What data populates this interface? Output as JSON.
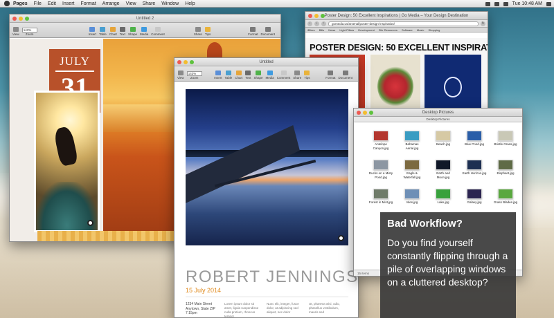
{
  "menubar": {
    "app": "Pages",
    "items": [
      "File",
      "Edit",
      "Insert",
      "Format",
      "Arrange",
      "View",
      "Share",
      "Window",
      "Help"
    ],
    "clock": "Tue 10:48 AM"
  },
  "toolbar": {
    "zoom_value": "143%",
    "view_label": "View",
    "zoom_label": "Zoom",
    "insert_label": "Insert",
    "table_label": "Table",
    "chart_label": "Chart",
    "text_label": "Text",
    "shape_label": "Shape",
    "media_label": "Media",
    "comment_label": "Comment",
    "share_label": "Share",
    "tips_label": "Tips",
    "format_label": "Format",
    "document_label": "Document"
  },
  "pages1": {
    "title": "Untitled 2",
    "month": "JULY",
    "day": "31"
  },
  "pages2": {
    "title": "Untitled",
    "name": "ROBERT JENNINGS",
    "date": "15 July 2014",
    "address_lines": [
      "1234 Main Street",
      "Anytown, State ZIP",
      "7:15pm"
    ],
    "col2": "Lorem ipsum dolor sit amet, ligula suspendisse nulla pretium, rhoncus tempor",
    "col3": "Nunc elit, integer, fusce dolor, at adipiscing sed aliquet, nec dolor",
    "col4": "Ut, pharetra wisi, odio, phasellus vestibulum, mauris sed"
  },
  "browser": {
    "title": "Poster Design: 50 Excellent Inspirations | Go Media – Your Design Destination",
    "url": "gomedia.us/arsenal/poster-design-inspiration/",
    "bookmarks": [
      "iBikes",
      "Bills",
      "News",
      "Light Pillars",
      "Development",
      "Zikr Resources",
      "Software",
      "Music",
      "Shopping"
    ],
    "headline": "POSTER DESIGN: 50 EXCELLENT INSPIRATIONS"
  },
  "finder": {
    "title": "Desktop Pictures",
    "path_label": "Desktop Pictures",
    "files": [
      {
        "name": "Antelope Canyon.jpg",
        "color": "#b3362e"
      },
      {
        "name": "Bahamas Aerial.jpg",
        "color": "#3a9cc2"
      },
      {
        "name": "Beach.jpg",
        "color": "#d6c9a4"
      },
      {
        "name": "Blue Pond.jpg",
        "color": "#2a5ea8"
      },
      {
        "name": "Bristle Grass.jpg",
        "color": "#c9c8b6"
      },
      {
        "name": "Ducks on a Misty Pond.jpg",
        "color": "#8c96a2"
      },
      {
        "name": "Eagle & Waterfall.jpg",
        "color": "#7c6a40"
      },
      {
        "name": "Earth and Moon.jpg",
        "color": "#101828"
      },
      {
        "name": "Earth Horizon.jpg",
        "color": "#1d2f52"
      },
      {
        "name": "Elephant.jpg",
        "color": "#5f6b46"
      },
      {
        "name": "Forest in Mist.jpg",
        "color": "#6f7b69"
      },
      {
        "name": "Isles.jpg",
        "color": "#6e8fb6"
      },
      {
        "name": "Lake.jpg",
        "color": "#38a13c"
      },
      {
        "name": "Galaxy.jpg",
        "color": "#2b2450"
      },
      {
        "name": "Grass Blades.jpg",
        "color": "#5aa83f"
      }
    ],
    "status": "15 items"
  },
  "callout": {
    "title": "Bad Workflow?",
    "body": "Do you find yourself constantly flipping through a pile of overlapping windows on a cluttered desktop?"
  }
}
